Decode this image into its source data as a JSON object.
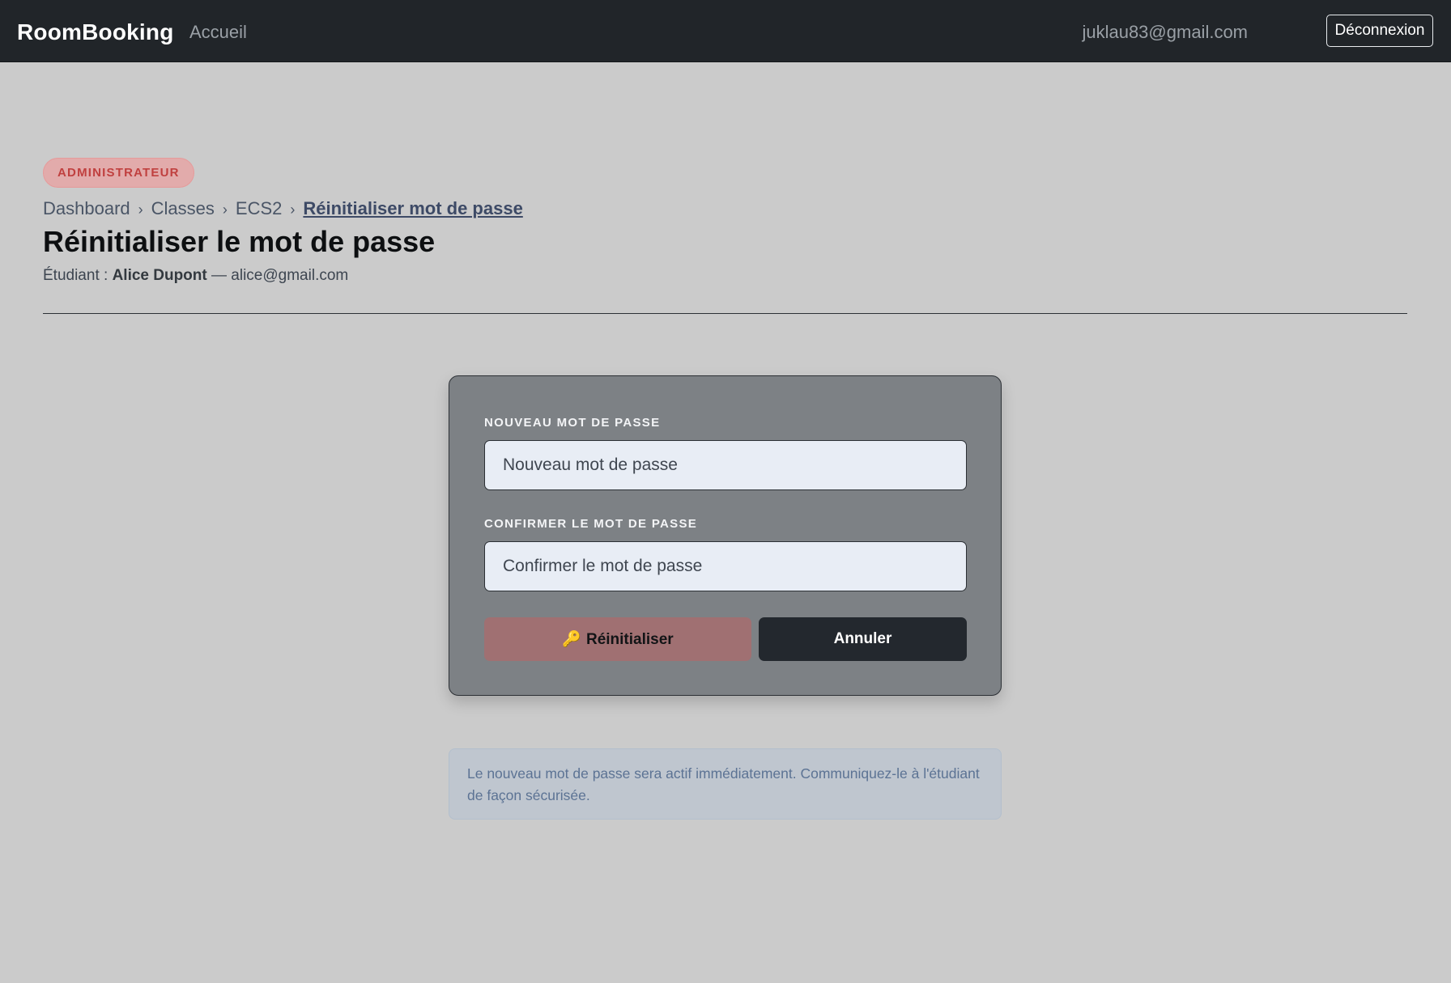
{
  "navbar": {
    "brand": "RoomBooking",
    "home_link": "Accueil",
    "user_email": "juklau83@gmail.com",
    "logout_label": "Déconnexion"
  },
  "header": {
    "role_badge": "ADMINISTRATEUR",
    "breadcrumb": {
      "items": [
        "Dashboard",
        "Classes",
        "ECS2"
      ],
      "separator": "›",
      "current": "Réinitialiser mot de passe"
    },
    "title": "Réinitialiser le mot de passe",
    "student": {
      "prefix": "Étudiant :",
      "name": "Alice Dupont",
      "dash": "—",
      "email": "alice@gmail.com"
    }
  },
  "form": {
    "new_password": {
      "label": "NOUVEAU MOT DE PASSE",
      "placeholder": "Nouveau mot de passe",
      "value": ""
    },
    "confirm_password": {
      "label": "CONFIRMER LE MOT DE PASSE",
      "placeholder": "Confirmer le mot de passe",
      "value": ""
    },
    "reset_button": {
      "icon": "key-icon",
      "label": "Réinitialiser"
    },
    "cancel_button": {
      "label": "Annuler"
    }
  },
  "info": {
    "message": "Le nouveau mot de passe sera actif immédiatement. Communiquez-le à l'étudiant de façon sécurisée."
  },
  "colors": {
    "navbar_bg": "#212529",
    "page_bg": "#cbcbcb",
    "badge_text": "#c0403f",
    "reset_button_bg": "#a07072",
    "cancel_button_bg": "#23282e",
    "info_text": "#5c7394"
  }
}
